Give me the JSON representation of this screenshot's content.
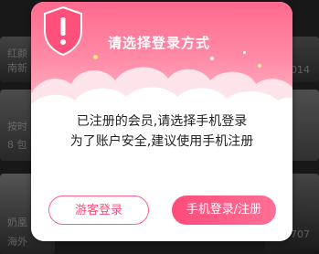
{
  "background": {
    "left_items": [
      "红颜",
      "南新",
      "按时",
      "8 包",
      "奶凰",
      "海外"
    ],
    "right_items": [
      "014",
      "707"
    ]
  },
  "dialog": {
    "icon": "shield-exclamation-icon",
    "title": "请选择登录方式",
    "message_line1": "已注册的会员,请选择手机登录",
    "message_line2": "为了账户安全,建议使用手机注册",
    "guest_button": "游客登录",
    "phone_button": "手机登录/注册"
  },
  "colors": {
    "accent": "#ff5e86",
    "header_top": "#ff6a8d",
    "header_bottom": "#ffb3c5",
    "button_fill": "#ff4b7a"
  }
}
